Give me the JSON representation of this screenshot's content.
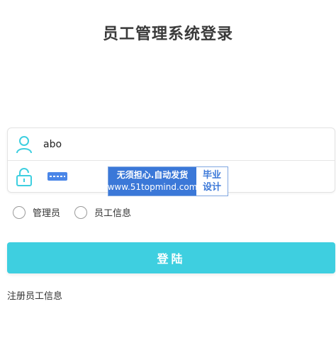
{
  "page": {
    "title": "员工管理系统登录"
  },
  "form": {
    "username_value": "abo",
    "password_masked": true
  },
  "watermark": {
    "line1": "无须担心.自动发货",
    "line2": "www.51topmind.com",
    "right_line1": "毕业",
    "right_line2": "设计"
  },
  "roles": [
    {
      "label": "管理员"
    },
    {
      "label": "员工信息"
    }
  ],
  "login_button": {
    "label": "登陆"
  },
  "register": {
    "label": "注册员工信息"
  },
  "colors": {
    "primary": "#3ecfe0",
    "icon": "#3ecfe0",
    "watermark_blue": "#3b78d8"
  },
  "icons": {
    "user": "user-icon",
    "lock": "lock-icon"
  }
}
